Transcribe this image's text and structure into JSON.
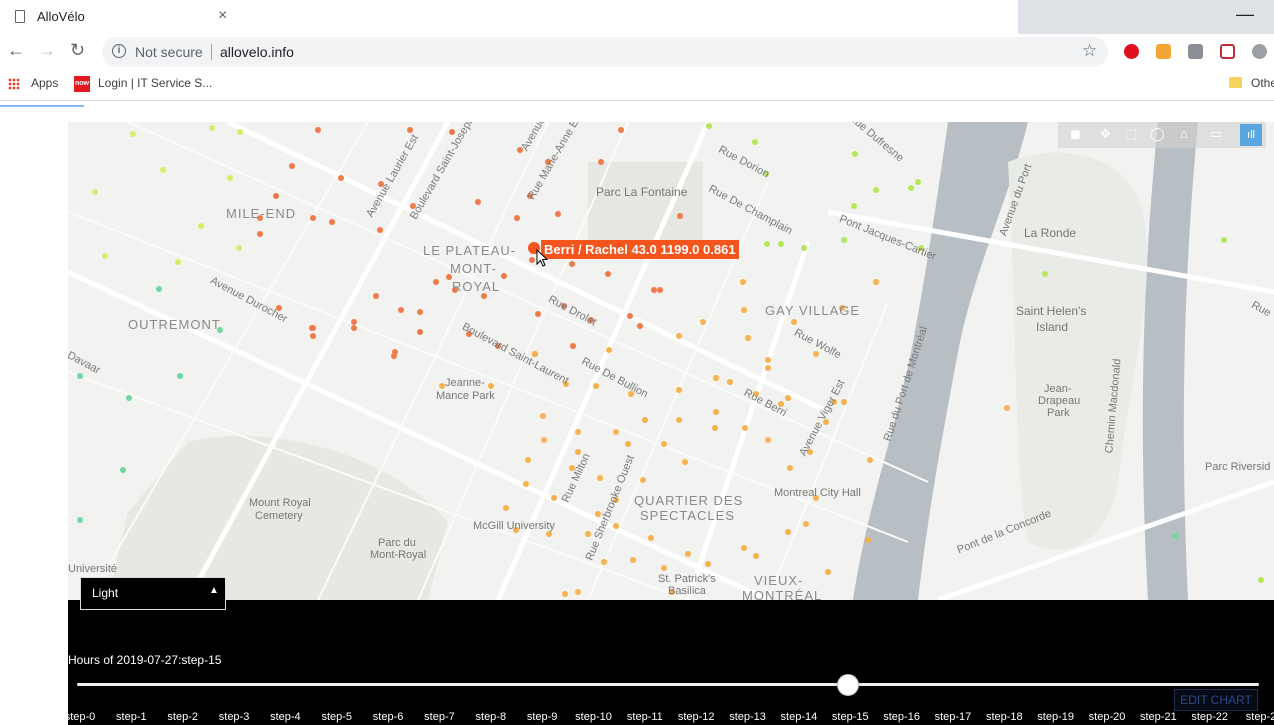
{
  "browser": {
    "tab_title": "AlloVélo",
    "tab_close": "×",
    "minimize": "—",
    "security_label": "Not secure",
    "url": "allovelo.info",
    "bookmarks": {
      "apps": "Apps",
      "login": "Login | IT Service S...",
      "login_icon_text": "now",
      "other": "Othe"
    }
  },
  "map": {
    "districts": [
      "MILE-END",
      "LE PLATEAU-",
      "MONT-",
      "ROYAL",
      "OUTREMONT",
      "GAY VILLAGE",
      "QUARTIER DES",
      "SPECTACLES",
      "VIEUX-",
      "MONTRÉAL"
    ],
    "places": [
      "Parc La Fontaine",
      "La Ronde",
      "Saint Helen's",
      "Island",
      "Jeanne-",
      "Mance Park",
      "Jean-",
      "Drapeau",
      "Park",
      "Mount Royal",
      "Cemetery",
      "Parc du",
      "Mont-Royal",
      "McGill University",
      "Montreal City Hall",
      "St. Patrick's",
      "Basilica",
      "Parc Riversid",
      "Université"
    ],
    "streets": [
      "Boulevard Saint-Joseph",
      "Avenue Laurier Est",
      "Rue Marie-Anne Est",
      "Avenue",
      "Rue Dorion",
      "Rue De Champlain",
      "Pont Jacques-Cartier",
      "Rue Dufresne",
      "Avenue du Port",
      "Avenue Durocher",
      "Rue Drolet",
      "Boulevard Saint-Laurent",
      "Rue De Bullion",
      "Rue Wolfe",
      "Rue Berri",
      "Avenue Viger Est",
      "Rue du Port de Montréal",
      "Rue Milton",
      "Rue Sherbrooke Ouest",
      "Pont de la Concorde",
      "Chemin Macdonald",
      "Rue Ve",
      "Davaar"
    ],
    "hover": {
      "station": "Berri / Rachel",
      "values": "43.0 1199.0 0.861"
    },
    "modebar_icons": [
      "camera-icon",
      "pan-icon",
      "box-select-icon",
      "lasso-icon",
      "home-icon",
      "tag-icon",
      "plotly-logo-icon"
    ],
    "marker_colors": {
      "high": "#f07a4a",
      "mid": "#f5b24e",
      "low": "#b8e65a",
      "min": "#6dd8a0"
    }
  },
  "controls": {
    "style_select": "Light",
    "slider_title": "Hours of 2019-07-27:step-15",
    "slider_active": 15,
    "steps": [
      "step-0",
      "step-1",
      "step-2",
      "step-3",
      "step-4",
      "step-5",
      "step-6",
      "step-7",
      "step-8",
      "step-9",
      "step-10",
      "step-11",
      "step-12",
      "step-13",
      "step-14",
      "step-15",
      "step-16",
      "step-17",
      "step-18",
      "step-19",
      "step-20",
      "step-21",
      "step-22",
      "step-2"
    ],
    "edit_chart": "EDIT CHART"
  }
}
